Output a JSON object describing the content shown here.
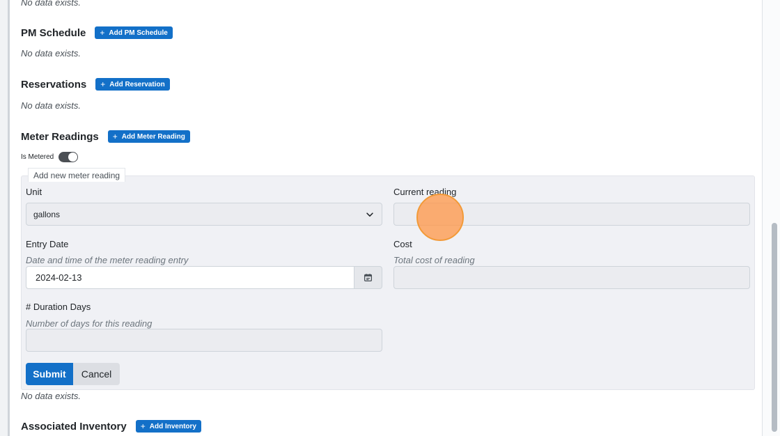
{
  "top_nodata": "No data exists.",
  "pm_schedule": {
    "title": "PM Schedule",
    "add_label": "Add PM Schedule",
    "nodata": "No data exists."
  },
  "reservations": {
    "title": "Reservations",
    "add_label": "Add Reservation",
    "nodata": "No data exists."
  },
  "meter_readings": {
    "title": "Meter Readings",
    "add_label": "Add Meter Reading",
    "is_metered_label": "Is Metered",
    "is_metered": true,
    "form": {
      "legend": "Add new meter reading",
      "unit": {
        "label": "Unit",
        "selected": "gallons"
      },
      "current_reading": {
        "label": "Current reading",
        "value": ""
      },
      "entry_date": {
        "label": "Entry Date",
        "help": "Date and time of the meter reading entry",
        "value": "2024-02-13"
      },
      "cost": {
        "label": "Cost",
        "help": "Total cost of reading",
        "value": ""
      },
      "duration": {
        "label": "# Duration Days",
        "help": "Number of days for this reading",
        "value": ""
      },
      "submit_label": "Submit",
      "cancel_label": "Cancel"
    },
    "nodata": "No data exists."
  },
  "associated_inventory": {
    "title": "Associated Inventory",
    "add_label": "Add Inventory"
  },
  "icons": {
    "add": "plus-icon",
    "select": "chevron-down-icon",
    "date": "calendar-icon"
  },
  "colors": {
    "primary": "#1370c8",
    "panel": "#f0f1f5",
    "cursor": "#f29a38"
  }
}
